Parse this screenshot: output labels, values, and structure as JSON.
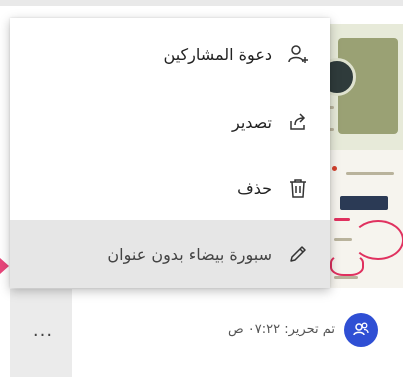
{
  "menu": {
    "items": [
      {
        "label": "دعوة المشاركين",
        "icon": "add-person-icon"
      },
      {
        "label": "تصدير",
        "icon": "share-export-icon"
      },
      {
        "label": "حذف",
        "icon": "trash-icon"
      },
      {
        "label": "سبورة بيضاء بدون عنوان",
        "icon": "pencil-icon",
        "selected": true
      }
    ]
  },
  "footer": {
    "more_label": "...",
    "edit_status": "تم تحرير: ٠٧:٢٢ ص"
  },
  "colors": {
    "accent": "#2f4fd4",
    "marker": "#e8457a",
    "selected_bg": "#e6e6e6"
  }
}
